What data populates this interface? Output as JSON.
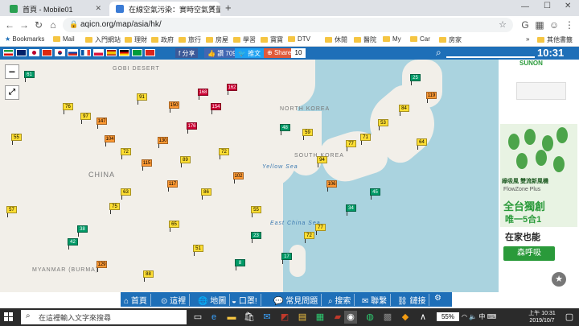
{
  "browser": {
    "tabs": [
      {
        "title": "首頁 - Mobile01",
        "favicon_color": "#2aa052"
      },
      {
        "title": "在線空氣污染：實時空氣質量指…",
        "favicon_color": "#3a7bd5"
      }
    ],
    "new_tab_label": "+",
    "url": "aqicn.org/map/asia/hk/",
    "bookmarks": [
      "Bookmarks",
      "Mail",
      "入門網站",
      "理財",
      "政府",
      "旅行",
      "房屋",
      "學習",
      "寶寶",
      "DTV",
      "休閒",
      "醫院",
      "My",
      "Car",
      "房家"
    ],
    "other_bookmarks": "其他書籤"
  },
  "site": {
    "share_fb": "分享",
    "like": "讚 709",
    "tweet": "推文",
    "share": "Share",
    "share_count": "10",
    "clock": "10:31",
    "bottom_nav": [
      "首頁",
      "這裡",
      "地圖",
      "口罩!",
      "常見問題",
      "搜索",
      "聯繫",
      "鏈接"
    ]
  },
  "map": {
    "labels": {
      "gobi": "GOBI DESERT",
      "china": "CHINA",
      "north_korea": "NORTH KOREA",
      "south_korea": "SOUTH KOREA",
      "yellow_sea": "Yellow Sea",
      "east_china_sea": "East China Sea",
      "myanmar": "MYANMAR (BURMA)"
    },
    "zoom_in": "+",
    "zoom_out": "−",
    "stations": [
      {
        "v": "61",
        "l": "g"
      },
      {
        "v": "76",
        "l": "y"
      },
      {
        "v": "91",
        "l": "y"
      },
      {
        "v": "97",
        "l": "y"
      },
      {
        "v": "147",
        "l": "o"
      },
      {
        "v": "55",
        "l": "y"
      },
      {
        "v": "104",
        "l": "o"
      },
      {
        "v": "72",
        "l": "y"
      },
      {
        "v": "150",
        "l": "o"
      },
      {
        "v": "168",
        "l": "r"
      },
      {
        "v": "154",
        "l": "r"
      },
      {
        "v": "162",
        "l": "r"
      },
      {
        "v": "176",
        "l": "r"
      },
      {
        "v": "130",
        "l": "o"
      },
      {
        "v": "115",
        "l": "o"
      },
      {
        "v": "89",
        "l": "y"
      },
      {
        "v": "57",
        "l": "y"
      },
      {
        "v": "42",
        "l": "g"
      },
      {
        "v": "38",
        "l": "g"
      },
      {
        "v": "75",
        "l": "y"
      },
      {
        "v": "63",
        "l": "y"
      },
      {
        "v": "117",
        "l": "o"
      },
      {
        "v": "86",
        "l": "y"
      },
      {
        "v": "72",
        "l": "y"
      },
      {
        "v": "102",
        "l": "o"
      },
      {
        "v": "48",
        "l": "g"
      },
      {
        "v": "55",
        "l": "y"
      },
      {
        "v": "59",
        "l": "y"
      },
      {
        "v": "94",
        "l": "y"
      },
      {
        "v": "106",
        "l": "o"
      },
      {
        "v": "77",
        "l": "y"
      },
      {
        "v": "71",
        "l": "y"
      },
      {
        "v": "53",
        "l": "y"
      },
      {
        "v": "84",
        "l": "y"
      },
      {
        "v": "25",
        "l": "g"
      },
      {
        "v": "119",
        "l": "o"
      },
      {
        "v": "64",
        "l": "y"
      },
      {
        "v": "45",
        "l": "g"
      },
      {
        "v": "34",
        "l": "g"
      },
      {
        "v": "77",
        "l": "y"
      },
      {
        "v": "17",
        "l": "g"
      },
      {
        "v": "72",
        "l": "y"
      },
      {
        "v": "23",
        "l": "g"
      },
      {
        "v": "8",
        "l": "g"
      },
      {
        "v": "88",
        "l": "y"
      },
      {
        "v": "129",
        "l": "o"
      },
      {
        "v": "51",
        "l": "y"
      },
      {
        "v": "65",
        "l": "y"
      }
    ]
  },
  "ad": {
    "brand": "SUNON",
    "tagline": "綠吸風 雙流新風機",
    "product": "FlowZone Plus",
    "line1": "全台獨創",
    "line2": "唯一5合1",
    "line3": "在家也能",
    "cta": "森呼吸"
  },
  "taskbar": {
    "search_placeholder": "在這裡輸入文字來搜尋",
    "battery": "55%",
    "ime": "中",
    "time_period": "上午 10:31",
    "date": "2019/10/7"
  }
}
